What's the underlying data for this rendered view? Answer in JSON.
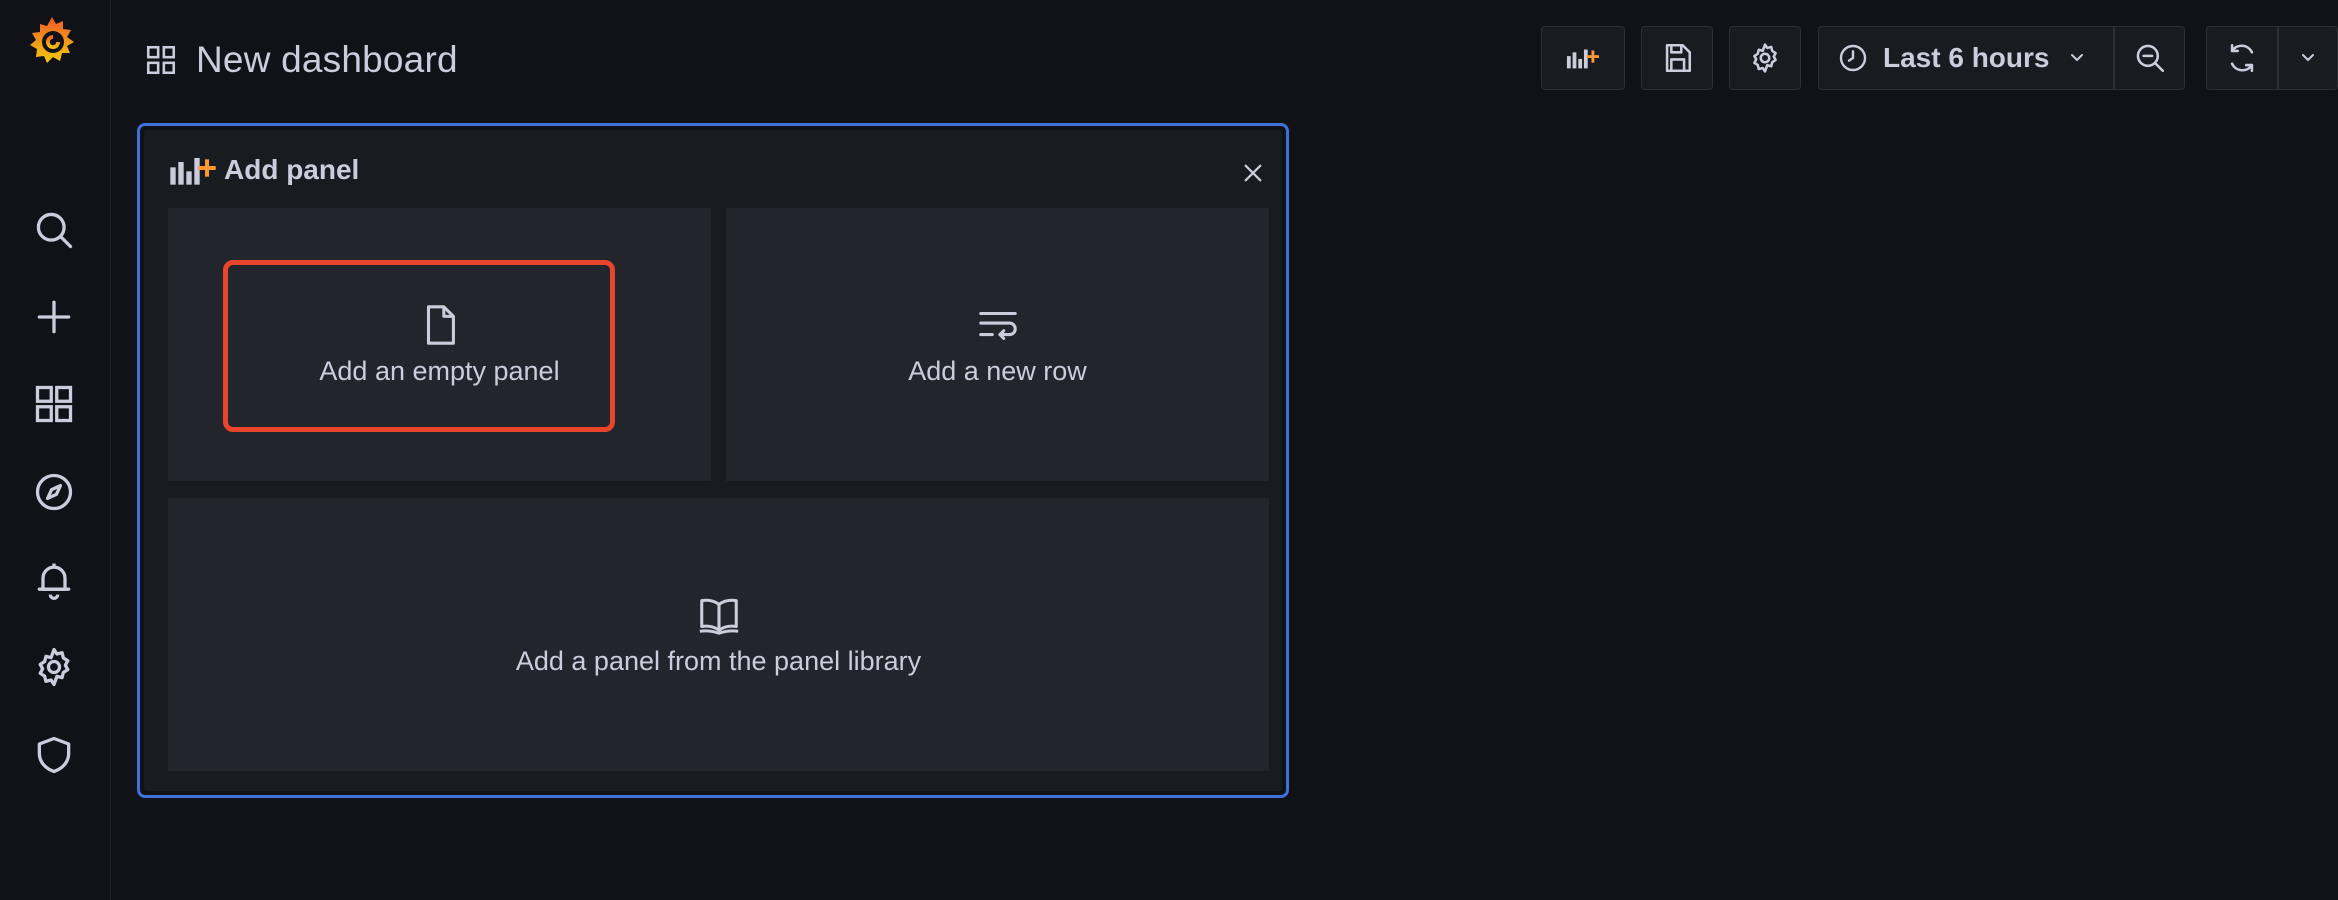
{
  "app": {
    "dashboard_title": "New dashboard"
  },
  "sidebar": {
    "items": [
      {
        "icon": "search-icon",
        "label": "Search"
      },
      {
        "icon": "plus-icon",
        "label": "Create"
      },
      {
        "icon": "dashboards-icon",
        "label": "Dashboards"
      },
      {
        "icon": "compass-icon",
        "label": "Explore"
      },
      {
        "icon": "bell-icon",
        "label": "Alerting"
      },
      {
        "icon": "gear-icon",
        "label": "Configuration"
      },
      {
        "icon": "shield-icon",
        "label": "Server Admin"
      }
    ]
  },
  "toolbar": {
    "time_range_label": "Last 6 hours",
    "buttons": [
      "add-panel-icon",
      "save-icon",
      "gear-icon",
      "clock-icon",
      "zoom-out-icon",
      "refresh-icon",
      "chevron-down-icon"
    ]
  },
  "add_panel": {
    "title": "Add panel",
    "options": {
      "empty_panel": "Add an empty panel",
      "new_row": "Add a new row",
      "library": "Add a panel from the panel library"
    }
  },
  "colors": {
    "background": "#111217",
    "panel": "#181b1f",
    "option": "#22252b",
    "focus_border": "#3d71d9",
    "highlight": "#e8452c",
    "accent_orange": "#ff9830"
  }
}
